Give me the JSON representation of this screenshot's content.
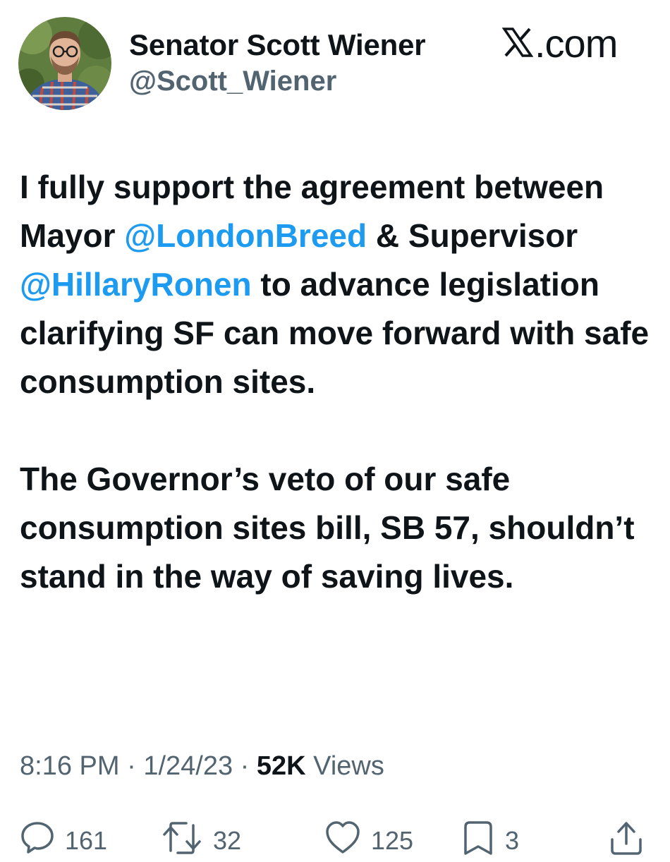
{
  "author": {
    "display_name": "Senator Scott Wiener",
    "handle": "@Scott_Wiener"
  },
  "source_label": ".com",
  "tweet": {
    "paragraph1": {
      "seg1": "I fully support the agreement between Mayor ",
      "mention1": "@LondonBreed",
      "seg2": " & Supervisor ",
      "mention2": "@HillaryRonen",
      "seg3": " to advance legislation clarifying SF can move forward with safe consumption sites."
    },
    "paragraph2": "The Governor’s veto of our safe consumption sites bill, SB 57, shouldn’t stand in the way of saving lives."
  },
  "meta": {
    "time": "8:16 PM",
    "separator": " · ",
    "date": "1/24/23",
    "views_count": "52K",
    "views_label": " Views"
  },
  "actions": {
    "replies": "161",
    "reposts": "32",
    "likes": "125",
    "bookmarks": "3"
  },
  "colors": {
    "text": "#0f1419",
    "secondary": "#536471",
    "link": "#1d9bf0"
  }
}
